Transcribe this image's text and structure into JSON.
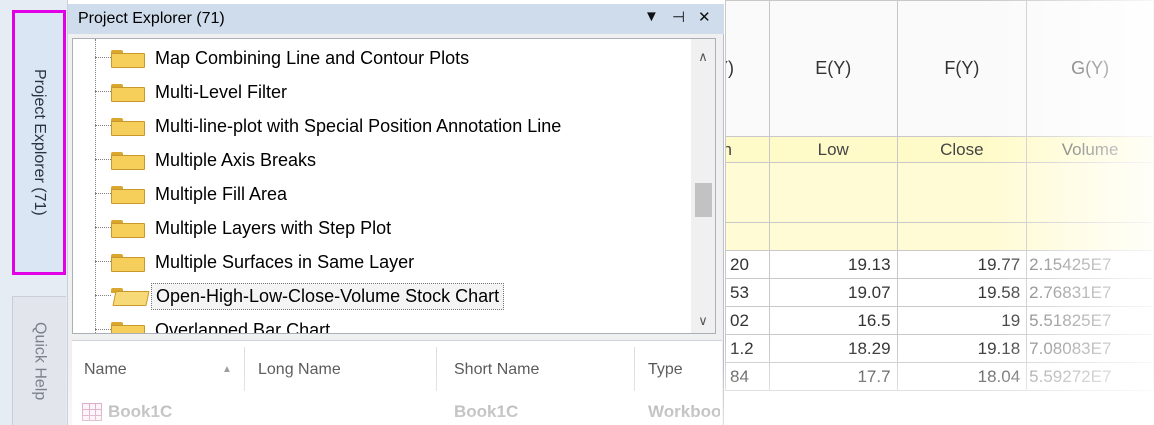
{
  "side_tabs": {
    "project_explorer": "Project Explorer (71)",
    "quick_help": "Quick Help"
  },
  "panel": {
    "title": "Project Explorer (71)",
    "dropdown_icon": "▼",
    "pin_icon": "⊣",
    "close_icon": "✕"
  },
  "tree": {
    "items": [
      "Map Combining Line and Contour Plots",
      "Multi-Level Filter",
      "Multi-line-plot with Special Position Annotation Line",
      "Multiple Axis Breaks",
      "Multiple Fill Area",
      "Multiple Layers with Step Plot",
      "Multiple Surfaces in Same Layer",
      "Open-High-Low-Close-Volume Stock Chart",
      "Overlapped Bar Chart"
    ],
    "selected_index": 7,
    "scroll_up": "∧",
    "scroll_down": "∨"
  },
  "list": {
    "columns": [
      "Name",
      "Long Name",
      "Short Name",
      "Type"
    ],
    "sort_arrow": "▲",
    "row": {
      "name": "Book1C",
      "long_name": "",
      "short_name": "Book1C",
      "type": "Workbook"
    }
  },
  "sheet": {
    "columns": [
      {
        "name": "D(Y)",
        "long_name": "High"
      },
      {
        "name": "E(Y)",
        "long_name": "Low"
      },
      {
        "name": "F(Y)",
        "long_name": "Close"
      },
      {
        "name": "G(Y)",
        "long_name": "Volume"
      }
    ],
    "rows": [
      [
        "20",
        "19.13",
        "19.77",
        "2.15425E7"
      ],
      [
        "53",
        "19.07",
        "19.58",
        "2.76831E7"
      ],
      [
        "02",
        "16.5",
        "19",
        "5.51825E7"
      ],
      [
        "1.2",
        "18.29",
        "19.18",
        "7.08083E7"
      ],
      [
        "84",
        "17.7",
        "18.04",
        "5.59272E7"
      ]
    ]
  },
  "colors": {
    "highlight_border": "#e100e6",
    "title_bar": "#cfdcec",
    "long_name_row": "#fffbc8"
  }
}
